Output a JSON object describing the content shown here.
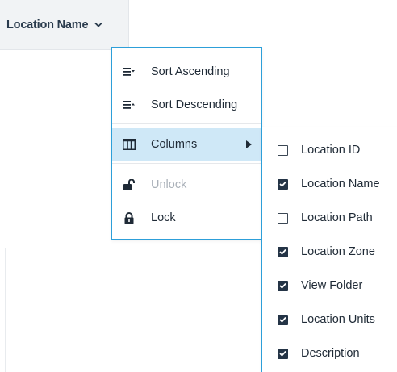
{
  "header": {
    "column_title": "Location Name",
    "menu_icon": "chevron-down-icon"
  },
  "column_menu": {
    "items": [
      {
        "label": "Sort Ascending",
        "icon": "sort-ascending-icon",
        "enabled": true
      },
      {
        "label": "Sort Descending",
        "icon": "sort-descending-icon",
        "enabled": true
      },
      {
        "label": "Columns",
        "icon": "columns-icon",
        "enabled": true,
        "active": true,
        "has_submenu": true
      },
      {
        "label": "Unlock",
        "icon": "unlock-icon",
        "enabled": false
      },
      {
        "label": "Lock",
        "icon": "lock-icon",
        "enabled": true
      }
    ]
  },
  "columns_submenu": {
    "items": [
      {
        "label": "Location ID",
        "checked": false
      },
      {
        "label": "Location Name",
        "checked": true
      },
      {
        "label": "Location Path",
        "checked": false
      },
      {
        "label": "Location Zone",
        "checked": true
      },
      {
        "label": "View Folder",
        "checked": true
      },
      {
        "label": "Location Units",
        "checked": true
      },
      {
        "label": "Description",
        "checked": true
      }
    ]
  },
  "colors": {
    "accent_border": "#2d9fd9",
    "active_bg": "#cfe8f7",
    "checkbox_fill": "#243446",
    "disabled_text": "#a9b0b8"
  }
}
